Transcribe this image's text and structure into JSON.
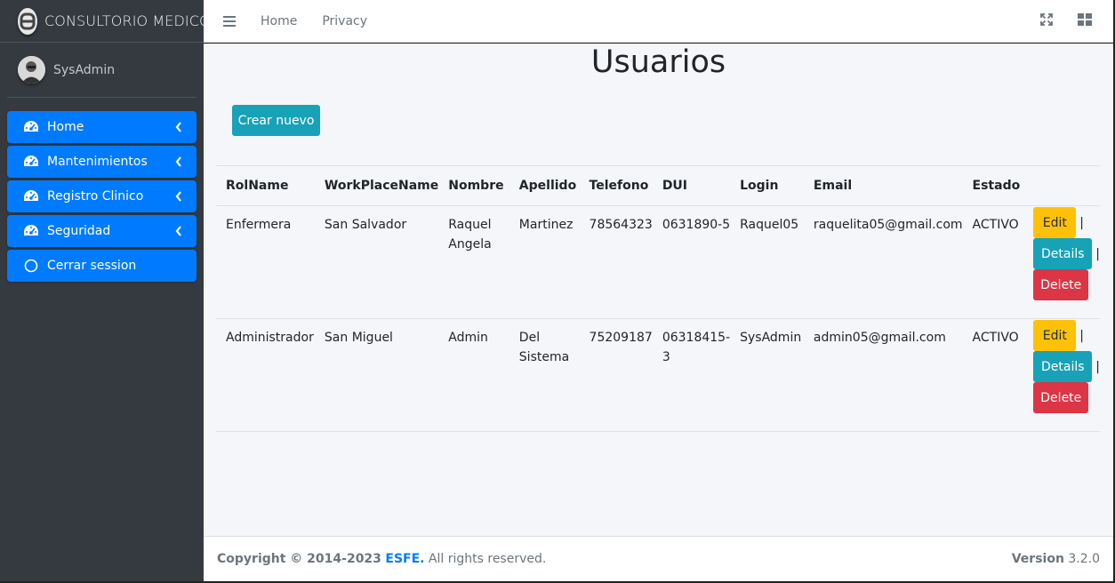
{
  "brand": {
    "name": "CONSULTORIO MEDICO",
    "logo_icon": "adminlte-logo-icon"
  },
  "user": {
    "name": "SysAdmin"
  },
  "sidebar": {
    "items": [
      {
        "label": "Home",
        "icon": "tachometer-icon",
        "has_children": true
      },
      {
        "label": "Mantenimientos",
        "icon": "tachometer-icon",
        "has_children": true
      },
      {
        "label": "Registro Clinico",
        "icon": "tachometer-icon",
        "has_children": true
      },
      {
        "label": "Seguridad",
        "icon": "tachometer-icon",
        "has_children": true
      },
      {
        "label": "Cerrar session",
        "icon": "circle-icon",
        "has_children": false
      }
    ],
    "accent": "#007bff",
    "background": "#343a40"
  },
  "topbar": {
    "links": [
      "Home",
      "Privacy"
    ],
    "icons": [
      "hamburger-icon",
      "expand-icon",
      "grid-icon"
    ]
  },
  "page": {
    "title": "Usuarios",
    "create_label": "Crear nuevo"
  },
  "table": {
    "headers": [
      "RolName",
      "WorkPlaceName",
      "Nombre",
      "Apellido",
      "Telefono",
      "DUI",
      "Login",
      "Email",
      "Estado"
    ],
    "rows": [
      {
        "rol": "Enfermera",
        "workplace": "San Salvador",
        "nombre": "Raquel Angela",
        "apellido": "Martinez",
        "telefono": "78564323",
        "dui": "0631890-5",
        "login": "Raquel05",
        "email": "raquelita05@gmail.com",
        "estado": "ACTIVO"
      },
      {
        "rol": "Administrador",
        "workplace": "San Miguel",
        "nombre": "Admin",
        "apellido": "Del Sistema",
        "telefono": "75209187",
        "dui": "06318415-3",
        "login": "SysAdmin",
        "email": "admin05@gmail.com",
        "estado": "ACTIVO"
      }
    ],
    "actions": {
      "edit": "Edit",
      "details": "Details",
      "delete": "Delete",
      "separator": "|"
    }
  },
  "footer": {
    "copyright": "Copyright © 2014-2023",
    "brand": "ESFE.",
    "rights": "All rights reserved.",
    "version_label": "Version",
    "version": "3.2.0"
  },
  "colors": {
    "info": "#17a2b8",
    "warning": "#ffc107",
    "danger": "#dc3545",
    "primary": "#007bff"
  }
}
